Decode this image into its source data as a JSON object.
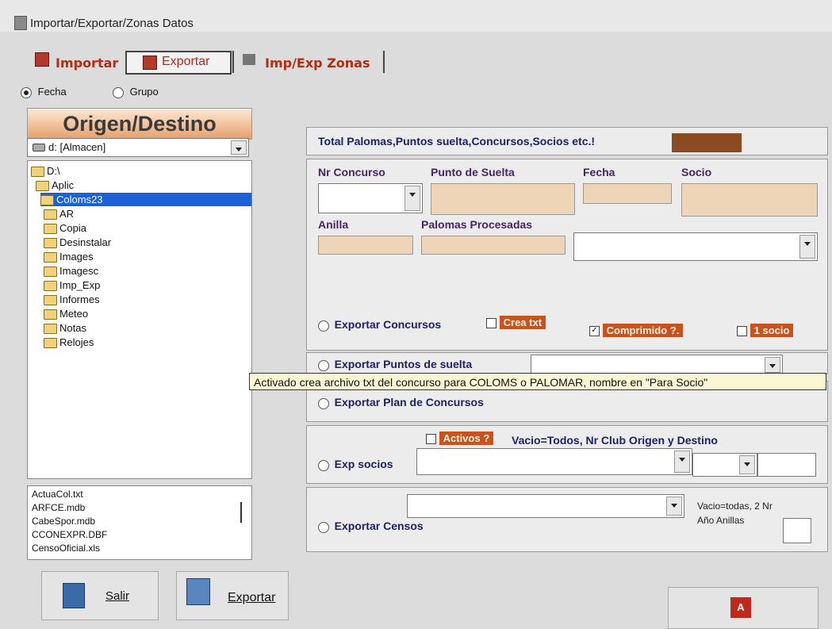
{
  "window": {
    "title": "Importar/Exportar/Zonas Datos"
  },
  "tabs": {
    "importar": "Importar",
    "exportar": "Exportar",
    "impexp": "Imp/Exp Zonas"
  },
  "radios": {
    "fecha": "Fecha",
    "grupo": "Grupo"
  },
  "origen": {
    "title": "Origen/Destino",
    "drive": "d: [Almacen]"
  },
  "tree": [
    "D:\\",
    "Aplic",
    "Coloms23",
    "AR",
    "Copia",
    "Desinstalar",
    "Images",
    "Imagesc",
    "Imp_Exp",
    "Informes",
    "Meteo",
    "Notas",
    "Relojes"
  ],
  "files": [
    "ActuaCol.txt",
    "ARFCE.mdb",
    "CabeSpor.mdb",
    "CCONEXPR.DBF",
    "CensoOficial.xls"
  ],
  "buttons": {
    "salir": "Salir",
    "exportar": "Exportar"
  },
  "total": {
    "label": "Total Palomas,Puntos suelta,Concursos,Socios etc.!"
  },
  "fields": {
    "nr_concurso": "Nr Concurso",
    "punto_suelta": "Punto de Suelta",
    "fecha": "Fecha",
    "socio": "Socio",
    "anilla": "Anilla",
    "palomas_procesadas": "Palomas Procesadas"
  },
  "options": {
    "exportar_concursos": "Exportar Concursos",
    "crea_txt": "Crea txt",
    "comprimido": "Comprimido ?.",
    "un_socio": "1 socio",
    "exportar_puntos": "Exportar Puntos de suelta",
    "exportar_plan": "Exportar Plan de Concursos",
    "activos": "Activos ?",
    "vacio_todos": "Vacio=Todos, Nr Club Origen y Destino",
    "exp_socios": "Exp socios",
    "exportar_censos": "Exportar Censos",
    "vacio_todas": "Vacio=todas, 2 Nr",
    "ano_anillas": "Año Anillas"
  },
  "tooltip": "Activado crea archivo txt del concurso para COLOMS o PALOMAR, nombre en \"Para Socio\"",
  "colors": {
    "accent": "#c8531c",
    "brown": "#8b4a1f",
    "selection": "#1c61d6",
    "field": "#efd5b8"
  }
}
